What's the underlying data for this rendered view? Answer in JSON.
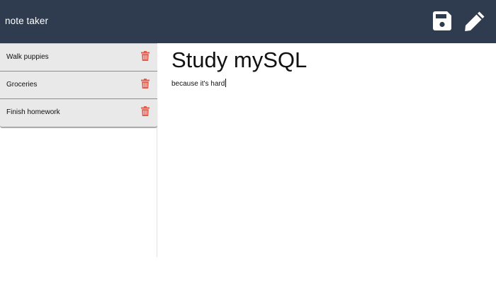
{
  "app": {
    "title": "note taker"
  },
  "toolbar": {
    "save_icon": "save-icon",
    "edit_icon": "pencil-icon"
  },
  "sidebar": {
    "notes": [
      {
        "title": "Walk puppies",
        "delete_icon": "trash-icon"
      },
      {
        "title": "Groceries",
        "delete_icon": "trash-icon"
      },
      {
        "title": "Finish homework",
        "delete_icon": "trash-icon"
      }
    ]
  },
  "editor": {
    "title": "Study mySQL",
    "text": "because it's hard"
  },
  "colors": {
    "navbar_background": "#2f3c50",
    "delete_icon": "#e45a4b",
    "list_item_background": "#e9e9e9"
  }
}
